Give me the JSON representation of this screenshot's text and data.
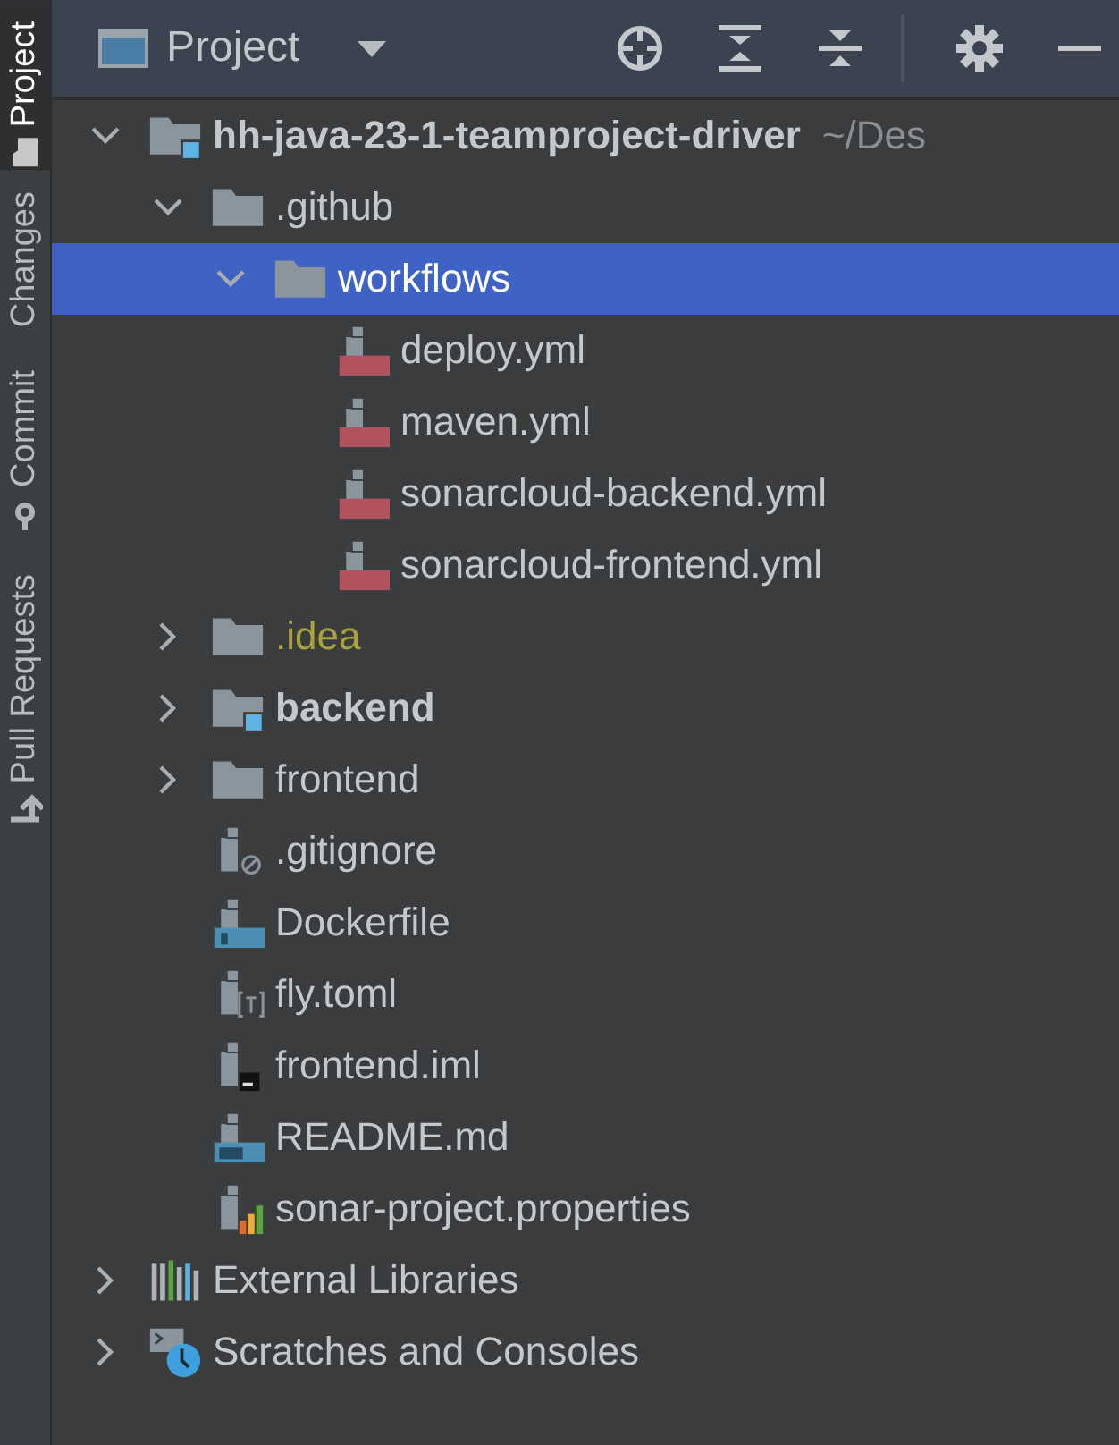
{
  "side_tabs": [
    {
      "label": "Project",
      "selected": true,
      "kind": "project"
    },
    {
      "label": "Changes",
      "selected": false,
      "kind": "changes"
    },
    {
      "label": "Commit",
      "selected": false,
      "kind": "commit"
    },
    {
      "label": "Pull Requests",
      "selected": false,
      "kind": "pull"
    }
  ],
  "header": {
    "title": "Project"
  },
  "tree": {
    "items": [
      {
        "label": "hh-java-23-1-teamproject-driver",
        "path": "~/Des",
        "kind": "module",
        "bold": true,
        "ignored": false,
        "expanded": true,
        "selected": false,
        "children": [
          {
            "label": ".github",
            "kind": "folder",
            "bold": false,
            "ignored": false,
            "expanded": true,
            "selected": false,
            "children": [
              {
                "label": "workflows",
                "kind": "folder",
                "bold": false,
                "ignored": false,
                "expanded": true,
                "selected": true,
                "children": [
                  {
                    "label": "deploy.yml",
                    "kind": "yml",
                    "bold": false,
                    "ignored": false,
                    "selected": false
                  },
                  {
                    "label": "maven.yml",
                    "kind": "yml",
                    "bold": false,
                    "ignored": false,
                    "selected": false
                  },
                  {
                    "label": "sonarcloud-backend.yml",
                    "kind": "yml",
                    "bold": false,
                    "ignored": false,
                    "selected": false
                  },
                  {
                    "label": "sonarcloud-frontend.yml",
                    "kind": "yml",
                    "bold": false,
                    "ignored": false,
                    "selected": false
                  }
                ]
              }
            ]
          },
          {
            "label": ".idea",
            "kind": "folder",
            "bold": false,
            "ignored": true,
            "expanded": false,
            "selected": false
          },
          {
            "label": "backend",
            "kind": "module",
            "bold": true,
            "ignored": false,
            "expanded": false,
            "selected": false
          },
          {
            "label": "frontend",
            "kind": "folder",
            "bold": false,
            "ignored": false,
            "expanded": false,
            "selected": false
          },
          {
            "label": ".gitignore",
            "kind": "gitignore",
            "bold": false,
            "ignored": false,
            "selected": false
          },
          {
            "label": "Dockerfile",
            "kind": "docker",
            "bold": false,
            "ignored": false,
            "selected": false
          },
          {
            "label": "fly.toml",
            "kind": "toml",
            "bold": false,
            "ignored": false,
            "selected": false
          },
          {
            "label": "frontend.iml",
            "kind": "iml",
            "bold": false,
            "ignored": false,
            "selected": false
          },
          {
            "label": "README.md",
            "kind": "md",
            "bold": false,
            "ignored": false,
            "selected": false
          },
          {
            "label": "sonar-project.properties",
            "kind": "properties",
            "bold": false,
            "ignored": false,
            "selected": false
          }
        ]
      },
      {
        "label": "External Libraries",
        "kind": "libraries",
        "bold": false,
        "ignored": false,
        "expanded": false,
        "selected": false
      },
      {
        "label": "Scratches and Consoles",
        "kind": "scratches",
        "bold": false,
        "ignored": false,
        "expanded": false,
        "selected": false
      }
    ]
  }
}
